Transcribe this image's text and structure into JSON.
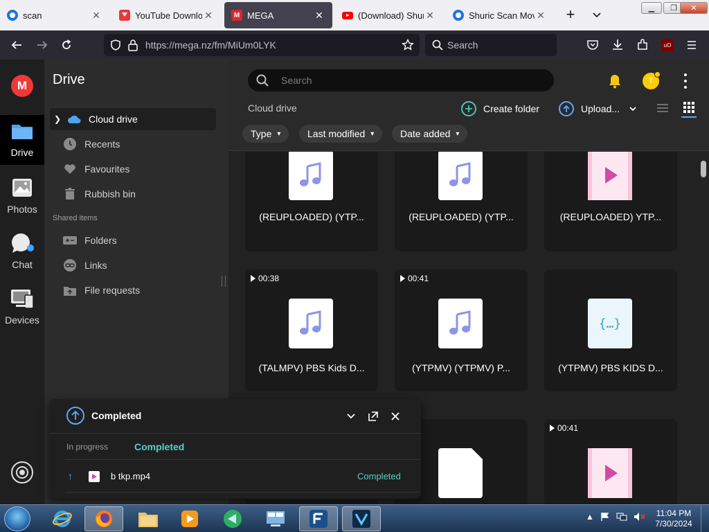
{
  "browser": {
    "tabs": [
      {
        "title": "scan",
        "icon": "scan-favicon"
      },
      {
        "title": "YouTube Download",
        "icon": "yt-downloader-favicon"
      },
      {
        "title": "MEGA",
        "icon": "mega-favicon",
        "active": true
      },
      {
        "title": "(Download) Shuric",
        "icon": "youtube-favicon"
      },
      {
        "title": "Shuric Scan Movie",
        "icon": "scan-favicon"
      }
    ],
    "url": "https://mega.nz/fm/MiUm0LYK",
    "search_placeholder": "Search",
    "extension_badge": "uO"
  },
  "rail": {
    "logo": "M",
    "items": [
      {
        "label": "Drive",
        "icon": "folder-icon",
        "active": true
      },
      {
        "label": "Photos",
        "icon": "photos-icon"
      },
      {
        "label": "Chat",
        "icon": "chat-icon"
      },
      {
        "label": "Devices",
        "icon": "devices-icon"
      }
    ]
  },
  "sidebar": {
    "title": "Drive",
    "items": [
      {
        "label": "Cloud drive",
        "icon": "cloud-icon",
        "active": true
      },
      {
        "label": "Recents",
        "icon": "clock-icon"
      },
      {
        "label": "Favourites",
        "icon": "heart-icon"
      },
      {
        "label": "Rubbish bin",
        "icon": "trash-icon"
      }
    ],
    "shared_title": "Shared items",
    "shared_items": [
      {
        "label": "Folders",
        "icon": "shared-folder-icon"
      },
      {
        "label": "Links",
        "icon": "link-icon"
      },
      {
        "label": "File requests",
        "icon": "file-request-icon"
      }
    ]
  },
  "main": {
    "search_placeholder": "Search",
    "avatar_initial": "T",
    "breadcrumb": "Cloud drive",
    "create_folder": "Create folder",
    "upload": "Upload...",
    "filters": [
      "Type",
      "Last modified",
      "Date added"
    ],
    "files": [
      {
        "name": "(REUPLOADED) (YTP...",
        "type": "audio",
        "duration": ""
      },
      {
        "name": "(REUPLOADED) (YTP...",
        "type": "audio",
        "duration": ""
      },
      {
        "name": "(REUPLOADED) YTP...",
        "type": "video",
        "duration": ""
      },
      {
        "name": "(TALMPV) PBS Kids D...",
        "type": "audio",
        "duration": "00:38"
      },
      {
        "name": "(YTPMV) (YTPMV) P...",
        "type": "audio",
        "duration": "00:41"
      },
      {
        "name": "(YTPMV) PBS KIDS D...",
        "type": "code",
        "duration": ""
      },
      {
        "name": "",
        "type": "generic",
        "duration": ""
      },
      {
        "name": "",
        "type": "generic",
        "duration": ""
      },
      {
        "name": "",
        "type": "video",
        "duration": "00:41"
      }
    ]
  },
  "transfer": {
    "title": "Completed",
    "tab_in_progress": "In progress",
    "tab_completed": "Completed",
    "rows": [
      {
        "file": "b tkp.mp4",
        "status": "Completed"
      }
    ]
  },
  "taskbar": {
    "time": "11:04 PM",
    "date": "7/30/2024"
  },
  "colors": {
    "mega_red": "#f0373a",
    "accent_teal": "#5ad0c4",
    "accent_blue": "#5aa8ff"
  }
}
